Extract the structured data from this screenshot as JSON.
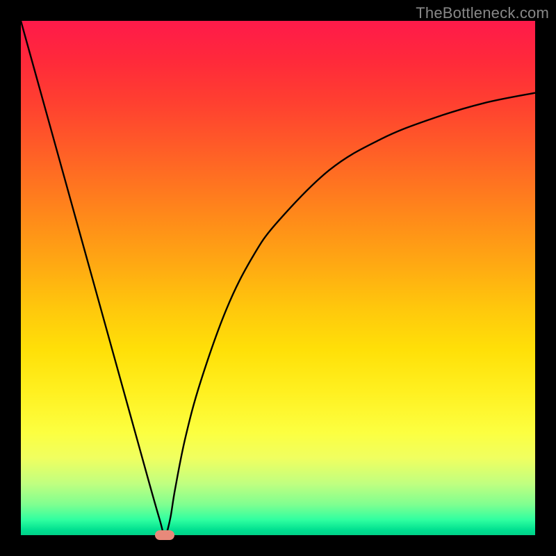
{
  "watermark": "TheBottleneck.com",
  "chart_data": {
    "type": "line",
    "title": "",
    "xlabel": "",
    "ylabel": "",
    "xlim": [
      0,
      100
    ],
    "ylim": [
      0,
      100
    ],
    "x": [
      0,
      5,
      10,
      15,
      20,
      25,
      27,
      28,
      29,
      30,
      32,
      35,
      40,
      45,
      50,
      60,
      70,
      80,
      90,
      100
    ],
    "values": [
      100,
      82,
      64,
      46,
      28,
      10,
      3,
      0,
      3,
      9,
      19,
      30,
      44,
      54,
      61,
      71,
      77,
      81,
      84,
      86
    ],
    "marker": {
      "x": 28,
      "y": 0
    },
    "gradient": {
      "top_color": "#ff1a4a",
      "bottom_color": "#00d088"
    }
  }
}
